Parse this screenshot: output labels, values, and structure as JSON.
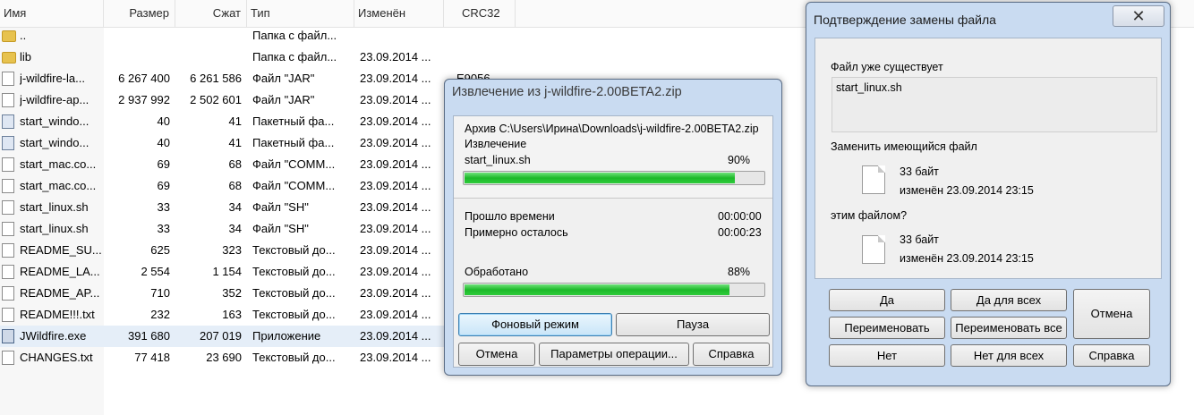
{
  "filelist": {
    "headers": {
      "name": "Имя",
      "size": "Размер",
      "packed": "Сжат",
      "type": "Тип",
      "modified": "Изменён",
      "crc": "CRC32"
    },
    "rows": [
      {
        "name": "..",
        "size": "",
        "packed": "",
        "type": "Папка с файл...",
        "date": "",
        "crc": "",
        "icon": "folder-icon"
      },
      {
        "name": "lib",
        "size": "",
        "packed": "",
        "type": "Папка с файл...",
        "date": "23.09.2014 ...",
        "crc": "",
        "icon": "folder-icon"
      },
      {
        "name": "j-wildfire-la...",
        "size": "6 267 400",
        "packed": "6 261 586",
        "type": "Файл \"JAR\"",
        "date": "23.09.2014 ...",
        "crc": "E9056",
        "icon": "file-icon"
      },
      {
        "name": "j-wildfire-ap...",
        "size": "2 937 992",
        "packed": "2 502 601",
        "type": "Файл \"JAR\"",
        "date": "23.09.2014 ...",
        "crc": "",
        "icon": "file-icon"
      },
      {
        "name": "start_windo...",
        "size": "40",
        "packed": "41",
        "type": "Пакетный фа...",
        "date": "23.09.2014 ...",
        "crc": "",
        "icon": "batch-file-icon"
      },
      {
        "name": "start_windo...",
        "size": "40",
        "packed": "41",
        "type": "Пакетный фа...",
        "date": "23.09.2014 ...",
        "crc": "",
        "icon": "batch-file-icon"
      },
      {
        "name": "start_mac.co...",
        "size": "69",
        "packed": "68",
        "type": "Файл \"COMM...",
        "date": "23.09.2014 ...",
        "crc": "",
        "icon": "file-icon"
      },
      {
        "name": "start_mac.co...",
        "size": "69",
        "packed": "68",
        "type": "Файл \"COMM...",
        "date": "23.09.2014 ...",
        "crc": "",
        "icon": "file-icon"
      },
      {
        "name": "start_linux.sh",
        "size": "33",
        "packed": "34",
        "type": "Файл \"SH\"",
        "date": "23.09.2014 ...",
        "crc": "",
        "icon": "file-icon"
      },
      {
        "name": "start_linux.sh",
        "size": "33",
        "packed": "34",
        "type": "Файл \"SH\"",
        "date": "23.09.2014 ...",
        "crc": "",
        "icon": "file-icon"
      },
      {
        "name": "README_SU...",
        "size": "625",
        "packed": "323",
        "type": "Текстовый до...",
        "date": "23.09.2014 ...",
        "crc": "",
        "icon": "text-file-icon"
      },
      {
        "name": "README_LA...",
        "size": "2 554",
        "packed": "1 154",
        "type": "Текстовый до...",
        "date": "23.09.2014 ...",
        "crc": "",
        "icon": "text-file-icon"
      },
      {
        "name": "README_AP...",
        "size": "710",
        "packed": "352",
        "type": "Текстовый до...",
        "date": "23.09.2014 ...",
        "crc": "",
        "icon": "text-file-icon"
      },
      {
        "name": "README!!!.txt",
        "size": "232",
        "packed": "163",
        "type": "Текстовый до...",
        "date": "23.09.2014 ...",
        "crc": "",
        "icon": "text-file-icon"
      },
      {
        "name": "JWildfire.exe",
        "size": "391 680",
        "packed": "207 019",
        "type": "Приложение",
        "date": "23.09.2014 ...",
        "crc": "",
        "icon": "exe-icon"
      },
      {
        "name": "CHANGES.txt",
        "size": "77 418",
        "packed": "23 690",
        "type": "Текстовый до...",
        "date": "23.09.2014 ...",
        "crc": "",
        "icon": "text-file-icon"
      }
    ]
  },
  "extract": {
    "title": "Извлечение из j-wildfire-2.00BETA2.zip",
    "archive_line": "Архив C:\\Users\\Ирина\\Downloads\\j-wildfire-2.00BETA2.zip",
    "action": "Извлечение",
    "current_file": "start_linux.sh",
    "file_percent_label": "90%",
    "file_progress": 0.9,
    "elapsed_label": "Прошло времени",
    "elapsed_value": "00:00:00",
    "remaining_label": "Примерно осталось",
    "remaining_value": "00:00:23",
    "processed_label": "Обработано",
    "processed_percent_label": "88%",
    "processed_progress": 0.88,
    "buttons": {
      "background": "Фоновый режим",
      "pause": "Пауза",
      "cancel": "Отмена",
      "options": "Параметры операции...",
      "help": "Справка"
    }
  },
  "confirm": {
    "title": "Подтверждение замены файла",
    "exists_label": "Файл уже существует",
    "filename": "start_linux.sh",
    "replace_label": "Заменить имеющийся файл",
    "old_size": "33 байт",
    "old_modified": "изменён 23.09.2014 23:15",
    "with_label": "этим файлом?",
    "new_size": "33 байт",
    "new_modified": "изменён 23.09.2014 23:15",
    "buttons": {
      "yes": "Да",
      "yes_all": "Да для всех",
      "rename": "Переименовать",
      "rename_all": "Переименовать все",
      "no": "Нет",
      "no_all": "Нет для всех",
      "cancel": "Отмена",
      "help": "Справка"
    },
    "close_glyph": "✕"
  }
}
